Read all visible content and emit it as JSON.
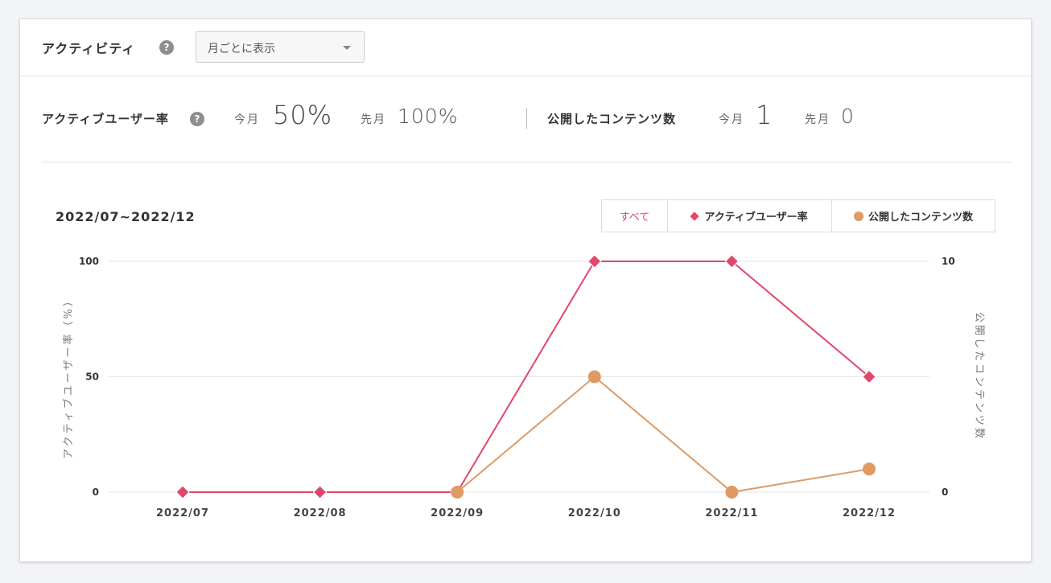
{
  "header": {
    "title": "アクティビティ",
    "help_icon": "?",
    "period_select": {
      "value": "月ごとに表示"
    }
  },
  "stats": {
    "active_rate": {
      "label": "アクティブユーザー率",
      "this_month_label": "今月",
      "this_month_value": "50%",
      "last_month_label": "先月",
      "last_month_value": "100%"
    },
    "published": {
      "label": "公開したコンテンツ数",
      "this_month_label": "今月",
      "this_month_value": "1",
      "last_month_label": "先月",
      "last_month_value": "0"
    }
  },
  "chart_header": {
    "range_label": "2022/07~2022/12",
    "legend": {
      "all": "すべて",
      "series1": "アクティブユーザー率",
      "series2": "公開したコンテンツ数"
    }
  },
  "chart_data": {
    "type": "line",
    "x": [
      "2022/07",
      "2022/08",
      "2022/09",
      "2022/10",
      "2022/11",
      "2022/12"
    ],
    "series": [
      {
        "name": "アクティブユーザー率",
        "axis": "left",
        "marker": "diamond",
        "color": "#e0476b",
        "values": [
          0,
          0,
          0,
          100,
          100,
          50
        ]
      },
      {
        "name": "公開したコンテンツ数",
        "axis": "right",
        "marker": "circle",
        "color": "#e09a64",
        "values": [
          null,
          null,
          0,
          5,
          0,
          1
        ]
      }
    ],
    "ylabel": "アクティブユーザー率（%）",
    "y2label": "公開したコンテンツ数",
    "ylim": [
      0,
      100
    ],
    "y2lim": [
      0,
      10
    ],
    "yticks": [
      "0",
      "50",
      "100"
    ],
    "y2ticks": [
      "0",
      "10"
    ],
    "grid": true
  }
}
